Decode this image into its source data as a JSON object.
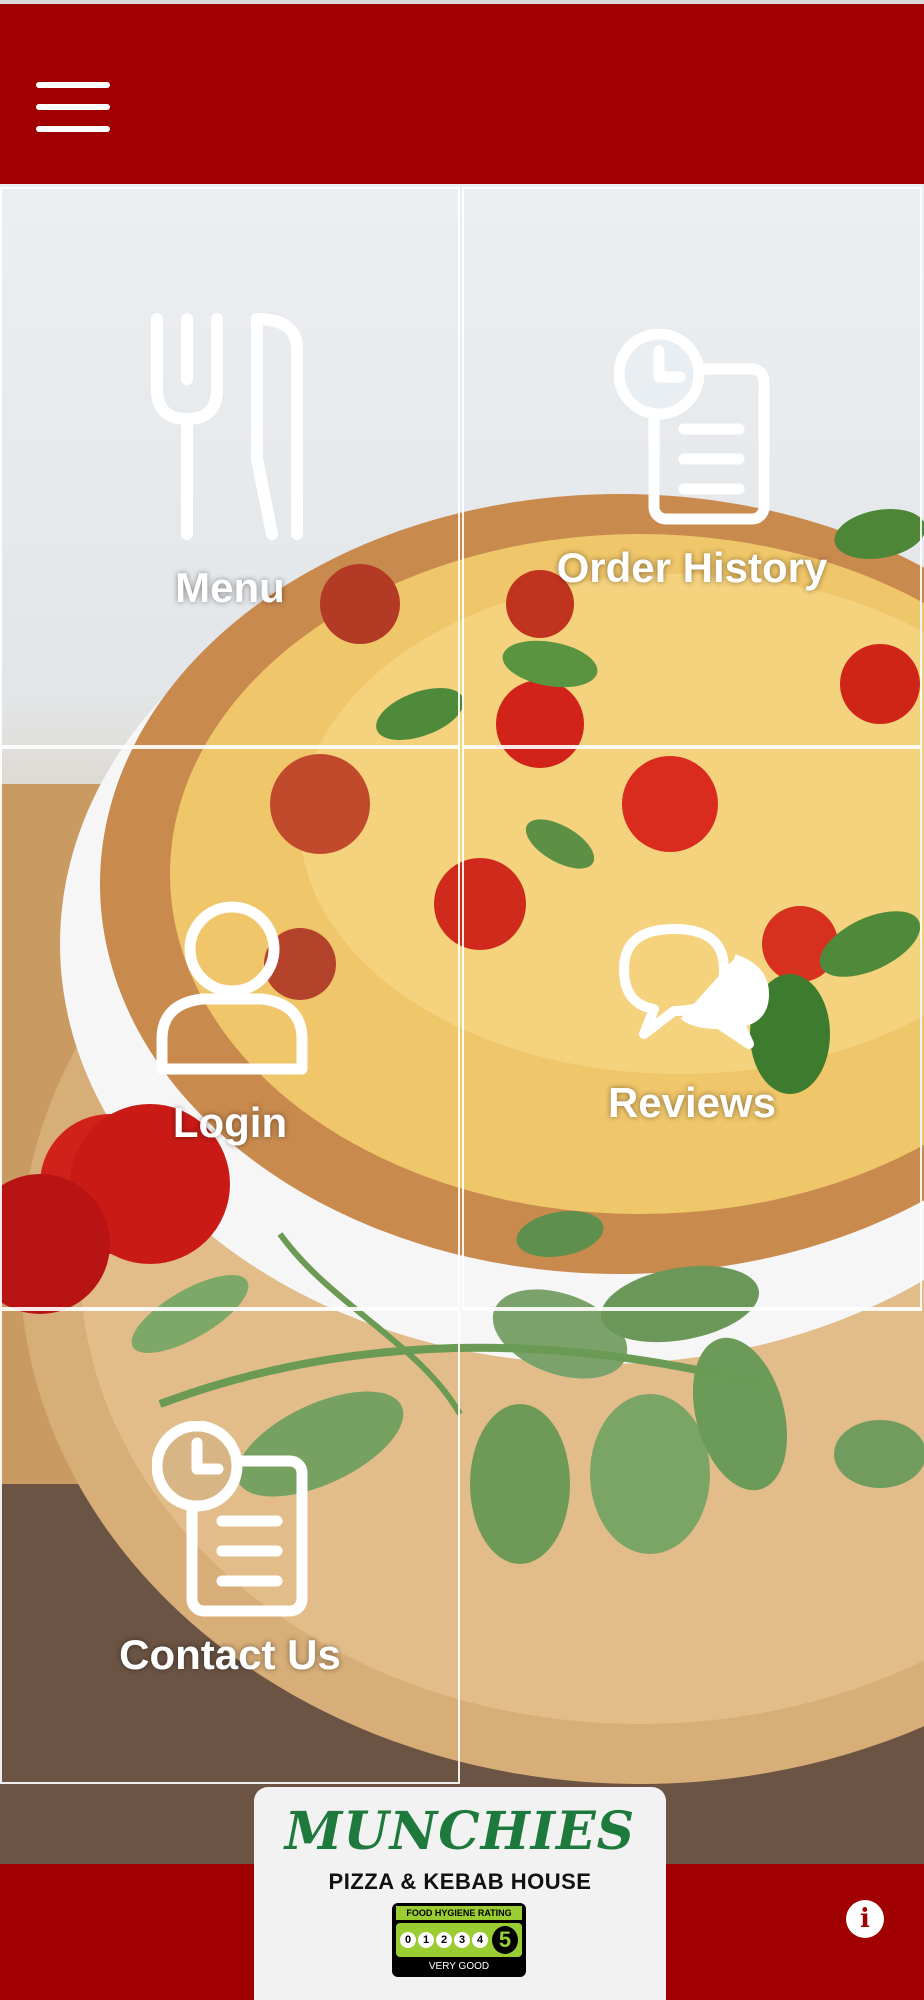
{
  "app": {
    "brand_color": "#a00000"
  },
  "header": {
    "menu_icon": "hamburger-menu-icon"
  },
  "tiles": [
    {
      "label": "Menu",
      "icon": "fork-knife-icon"
    },
    {
      "label": "Order History",
      "icon": "clock-document-icon"
    },
    {
      "label": "Login",
      "icon": "user-icon"
    },
    {
      "label": "Reviews",
      "icon": "chat-bubbles-icon"
    },
    {
      "label": "Contact Us",
      "icon": "clock-document-icon"
    }
  ],
  "logo": {
    "title": "MUNCHIES",
    "subtitle": "PIZZA & KEBAB HOUSE",
    "hygiene": {
      "heading": "FOOD HYGIENE RATING",
      "scale": [
        "0",
        "1",
        "2",
        "3",
        "4"
      ],
      "rating": "5",
      "text": "VERY GOOD"
    }
  },
  "footer": {
    "info_icon": "info-icon",
    "info_glyph": "i"
  }
}
